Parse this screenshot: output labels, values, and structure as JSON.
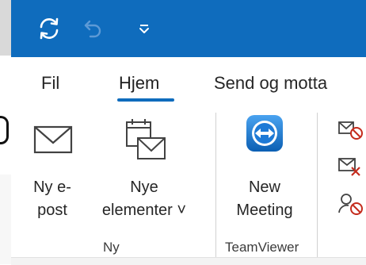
{
  "toolbar": {
    "sync_icon": "sync-icon",
    "undo_icon": "undo-icon",
    "customize_icon": "chevron-down-icon"
  },
  "tabs": [
    {
      "label": "Fil"
    },
    {
      "label": "Hjem",
      "active": true
    },
    {
      "label": "Send og motta"
    }
  ],
  "ribbon": {
    "new_mail": {
      "line1": "Ny e-",
      "line2": "post"
    },
    "new_items": {
      "line1": "Nye",
      "line2": "elementer ˅"
    },
    "group_ny": "Ny",
    "new_meeting": {
      "line1": "New",
      "line2": "Meeting"
    },
    "group_teamviewer": "TeamViewer"
  },
  "colors": {
    "titlebar": "#0f6cbd",
    "accent": "#0f6cbd",
    "danger": "#c42b1c"
  }
}
